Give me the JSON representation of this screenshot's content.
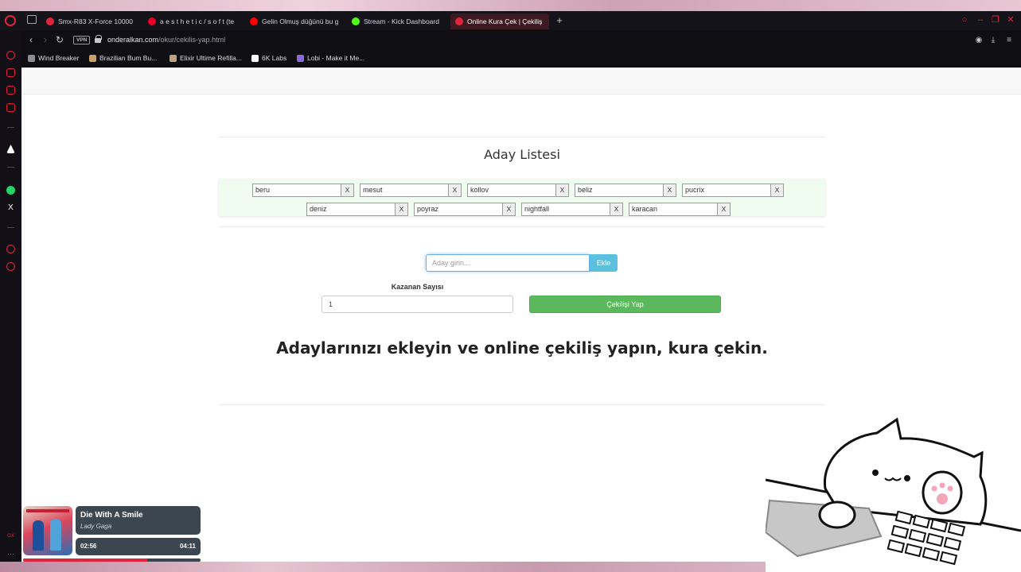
{
  "browser": {
    "tabs": [
      {
        "title": "Smx-R83 X-Force 10000",
        "color": "#e0243b",
        "active": false
      },
      {
        "title": "a e s t h e t i c / s o f t (te",
        "color": "#e60023",
        "active": false
      },
      {
        "title": "Gelin Olmuş düğünü bu g",
        "color": "#ff0000",
        "active": false
      },
      {
        "title": "Stream - Kick Dashboard",
        "color": "#53fc18",
        "active": false
      },
      {
        "title": "Online Kura Çek | Çekiliş",
        "color": "#e0243b",
        "active": true
      }
    ],
    "vpn_label": "VPN",
    "url_host": "onderalkan.com",
    "url_path": "/okur/cekilis-yap.html",
    "bookmarks": [
      {
        "label": "Wind Breaker",
        "color": "#8c8c94"
      },
      {
        "label": "Brazilian Bum Bu...",
        "color": "#c7a06a"
      },
      {
        "label": "Elixir Ultime Refilla...",
        "color": "#b9a27c"
      },
      {
        "label": "6K Labs",
        "color": "#ffffff"
      },
      {
        "label": "Lobi - Make it Me...",
        "color": "#8a6ad9"
      }
    ]
  },
  "page": {
    "list_title": "Aday Listesi",
    "delete_label": "X",
    "candidates_row1": [
      "beru",
      "mesut",
      "kollov",
      "beliz",
      "pucrix"
    ],
    "candidates_row2": [
      "deniz",
      "poyraz",
      "nightfall",
      "karacan"
    ],
    "add_placeholder": "Aday girin...",
    "add_button": "Ekle",
    "winners_label": "Kazanan Sayısı",
    "winners_value": "1",
    "draw_button": "Çekilişi Yap",
    "headline": "Adaylarınızı ekleyin ve online çekiliş yapın, kura çekin."
  },
  "now_playing": {
    "title": "Die With A Smile",
    "artist": "Lady Gaga",
    "current_time": "02:56",
    "total_time": "04:11",
    "progress_fraction": 0.7
  },
  "colors": {
    "accent": "#e0243b",
    "add_button": "#5bc0de",
    "draw_button": "#5cb85c",
    "candidate_panel": "#f1fcf0"
  }
}
